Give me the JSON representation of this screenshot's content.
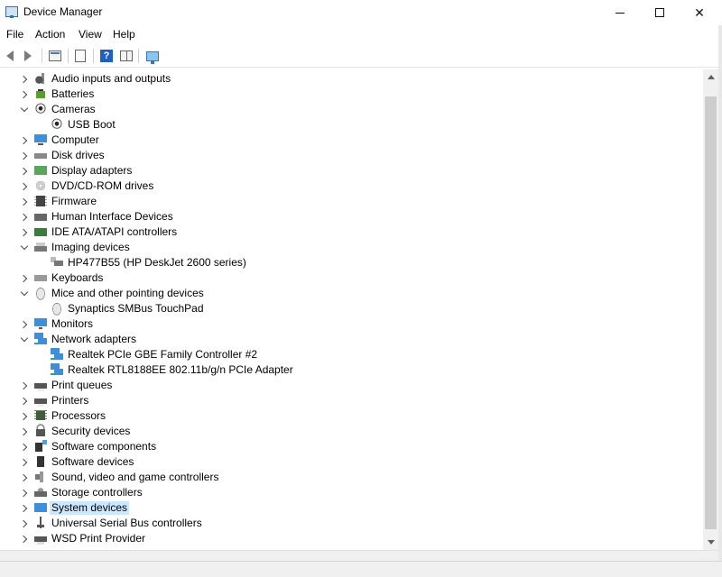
{
  "window": {
    "title": "Device Manager"
  },
  "menu": {
    "items": [
      "File",
      "Action",
      "View",
      "Help"
    ]
  },
  "toolbar": {
    "buttons": [
      "back-icon",
      "forward-icon",
      "properties-icon",
      "sheet-icon",
      "help-icon",
      "grid-icon",
      "monitor-icon"
    ]
  },
  "tree": {
    "rows": [
      {
        "label": "Audio inputs and outputs",
        "level": 0,
        "state": "collapsed",
        "icon": "audio-icon"
      },
      {
        "label": "Batteries",
        "level": 0,
        "state": "collapsed",
        "icon": "battery-icon"
      },
      {
        "label": "Cameras",
        "level": 0,
        "state": "expanded",
        "icon": "camera-icon"
      },
      {
        "label": "USB Boot",
        "level": 1,
        "state": "leaf",
        "icon": "camera-icon"
      },
      {
        "label": "Computer",
        "level": 0,
        "state": "collapsed",
        "icon": "computer-icon"
      },
      {
        "label": "Disk drives",
        "level": 0,
        "state": "collapsed",
        "icon": "disk-icon"
      },
      {
        "label": "Display adapters",
        "level": 0,
        "state": "collapsed",
        "icon": "display-adapter-icon"
      },
      {
        "label": "DVD/CD-ROM drives",
        "level": 0,
        "state": "collapsed",
        "icon": "dvd-icon"
      },
      {
        "label": "Firmware",
        "level": 0,
        "state": "collapsed",
        "icon": "firmware-icon"
      },
      {
        "label": "Human Interface Devices",
        "level": 0,
        "state": "collapsed",
        "icon": "hid-icon"
      },
      {
        "label": "IDE ATA/ATAPI controllers",
        "level": 0,
        "state": "collapsed",
        "icon": "ide-icon"
      },
      {
        "label": "Imaging devices",
        "level": 0,
        "state": "expanded",
        "icon": "imaging-icon"
      },
      {
        "label": "HP477B55 (HP DeskJet 2600 series)",
        "level": 1,
        "state": "leaf",
        "icon": "printer-device-icon"
      },
      {
        "label": "Keyboards",
        "level": 0,
        "state": "collapsed",
        "icon": "keyboard-icon"
      },
      {
        "label": "Mice and other pointing devices",
        "level": 0,
        "state": "expanded",
        "icon": "mouse-icon"
      },
      {
        "label": "Synaptics SMBus TouchPad",
        "level": 1,
        "state": "leaf",
        "icon": "mouse-icon"
      },
      {
        "label": "Monitors",
        "level": 0,
        "state": "collapsed",
        "icon": "monitor-icon"
      },
      {
        "label": "Network adapters",
        "level": 0,
        "state": "expanded",
        "icon": "network-icon"
      },
      {
        "label": "Realtek PCIe GBE Family Controller #2",
        "level": 1,
        "state": "leaf",
        "icon": "network-icon"
      },
      {
        "label": "Realtek RTL8188EE 802.11b/g/n PCIe Adapter",
        "level": 1,
        "state": "leaf",
        "icon": "network-icon"
      },
      {
        "label": "Print queues",
        "level": 0,
        "state": "collapsed",
        "icon": "print-queue-icon"
      },
      {
        "label": "Printers",
        "level": 0,
        "state": "collapsed",
        "icon": "printer-icon"
      },
      {
        "label": "Processors",
        "level": 0,
        "state": "collapsed",
        "icon": "processor-icon"
      },
      {
        "label": "Security devices",
        "level": 0,
        "state": "collapsed",
        "icon": "security-icon"
      },
      {
        "label": "Software components",
        "level": 0,
        "state": "collapsed",
        "icon": "software-component-icon"
      },
      {
        "label": "Software devices",
        "level": 0,
        "state": "collapsed",
        "icon": "software-device-icon"
      },
      {
        "label": "Sound, video and game controllers",
        "level": 0,
        "state": "collapsed",
        "icon": "sound-icon"
      },
      {
        "label": "Storage controllers",
        "level": 0,
        "state": "collapsed",
        "icon": "storage-icon"
      },
      {
        "label": "System devices",
        "level": 0,
        "state": "collapsed",
        "icon": "system-icon",
        "selected": true
      },
      {
        "label": "Universal Serial Bus controllers",
        "level": 0,
        "state": "collapsed",
        "icon": "usb-icon"
      },
      {
        "label": "WSD Print Provider",
        "level": 0,
        "state": "collapsed",
        "icon": "wsd-icon"
      }
    ]
  },
  "colors": {
    "selection": "#cce8ff",
    "scrollbar_track": "#f0f0f0",
    "scrollbar_thumb": "#cdcdcd"
  }
}
